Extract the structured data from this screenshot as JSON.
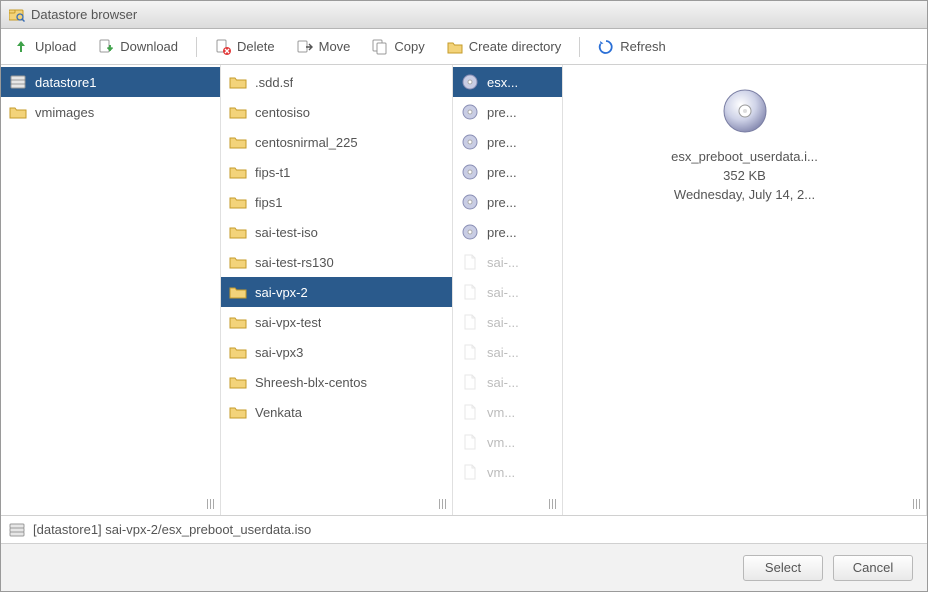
{
  "window": {
    "title": "Datastore browser"
  },
  "toolbar": {
    "upload": "Upload",
    "download": "Download",
    "delete": "Delete",
    "move": "Move",
    "copy": "Copy",
    "create_dir": "Create directory",
    "refresh": "Refresh"
  },
  "col1": {
    "items": [
      {
        "kind": "datastore",
        "label": "datastore1",
        "selected": true
      },
      {
        "kind": "folder",
        "label": "vmimages",
        "selected": false
      }
    ]
  },
  "col2": {
    "items": [
      {
        "kind": "folder",
        "label": ".sdd.sf",
        "selected": false
      },
      {
        "kind": "folder",
        "label": "centosiso",
        "selected": false
      },
      {
        "kind": "folder",
        "label": "centosnirmal_225",
        "selected": false
      },
      {
        "kind": "folder",
        "label": "fips-t1",
        "selected": false
      },
      {
        "kind": "folder",
        "label": "fips1",
        "selected": false
      },
      {
        "kind": "folder",
        "label": "sai-test-iso",
        "selected": false
      },
      {
        "kind": "folder",
        "label": "sai-test-rs130",
        "selected": false
      },
      {
        "kind": "folder",
        "label": "sai-vpx-2",
        "selected": true
      },
      {
        "kind": "folder",
        "label": "sai-vpx-test",
        "selected": false
      },
      {
        "kind": "folder",
        "label": "sai-vpx3",
        "selected": false
      },
      {
        "kind": "folder",
        "label": "Shreesh-blx-centos",
        "selected": false
      },
      {
        "kind": "folder",
        "label": "Venkata",
        "selected": false
      }
    ]
  },
  "col3": {
    "items": [
      {
        "kind": "disc",
        "label": "esx...",
        "selected": true,
        "faded": false
      },
      {
        "kind": "disc",
        "label": "pre...",
        "selected": false,
        "faded": false
      },
      {
        "kind": "disc",
        "label": "pre...",
        "selected": false,
        "faded": false
      },
      {
        "kind": "disc",
        "label": "pre...",
        "selected": false,
        "faded": false
      },
      {
        "kind": "disc",
        "label": "pre...",
        "selected": false,
        "faded": false
      },
      {
        "kind": "disc",
        "label": "pre...",
        "selected": false,
        "faded": false
      },
      {
        "kind": "file",
        "label": "sai-...",
        "selected": false,
        "faded": true
      },
      {
        "kind": "file",
        "label": "sai-...",
        "selected": false,
        "faded": true
      },
      {
        "kind": "file",
        "label": "sai-...",
        "selected": false,
        "faded": true
      },
      {
        "kind": "file",
        "label": "sai-...",
        "selected": false,
        "faded": true
      },
      {
        "kind": "file",
        "label": "sai-...",
        "selected": false,
        "faded": true
      },
      {
        "kind": "file",
        "label": "vm...",
        "selected": false,
        "faded": true
      },
      {
        "kind": "file",
        "label": "vm...",
        "selected": false,
        "faded": true
      },
      {
        "kind": "file",
        "label": "vm...",
        "selected": false,
        "faded": true
      }
    ]
  },
  "preview": {
    "filename": "esx_preboot_userdata.i...",
    "size": "352 KB",
    "date": "Wednesday, July 14, 2..."
  },
  "status": {
    "path": "[datastore1] sai-vpx-2/esx_preboot_userdata.iso"
  },
  "footer": {
    "select": "Select",
    "cancel": "Cancel"
  }
}
